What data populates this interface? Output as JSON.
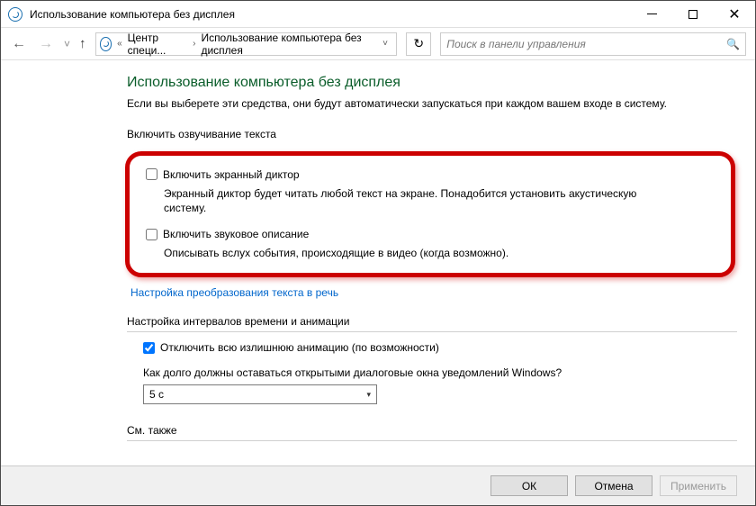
{
  "window": {
    "title": "Использование компьютера без дисплея"
  },
  "nav": {
    "crumb1": "Центр специ...",
    "crumb2": "Использование компьютера без дисплея",
    "search_placeholder": "Поиск в панели управления"
  },
  "page": {
    "title": "Использование компьютера без дисплея",
    "description": "Если вы выберете эти средства, они будут автоматически запускаться при каждом вашем входе в систему."
  },
  "section1": {
    "header": "Включить озвучивание текста",
    "narrator_label": "Включить экранный диктор",
    "narrator_desc": "Экранный диктор будет читать любой текст на экране. Понадобится установить акустическую систему.",
    "audio_label": "Включить звуковое описание",
    "audio_desc": "Описывать вслух события, происходящие в видео (когда возможно).",
    "tts_link": "Настройка преобразования текста в речь"
  },
  "section2": {
    "header": "Настройка интервалов времени и анимации",
    "anim_label": "Отключить всю излишнюю анимацию (по возможности)",
    "duration_label": "Как долго должны оставаться открытыми диалоговые окна уведомлений Windows?",
    "duration_value": "5 с"
  },
  "see_also": "См. также",
  "footer": {
    "ok": "ОК",
    "cancel": "Отмена",
    "apply": "Применить"
  }
}
